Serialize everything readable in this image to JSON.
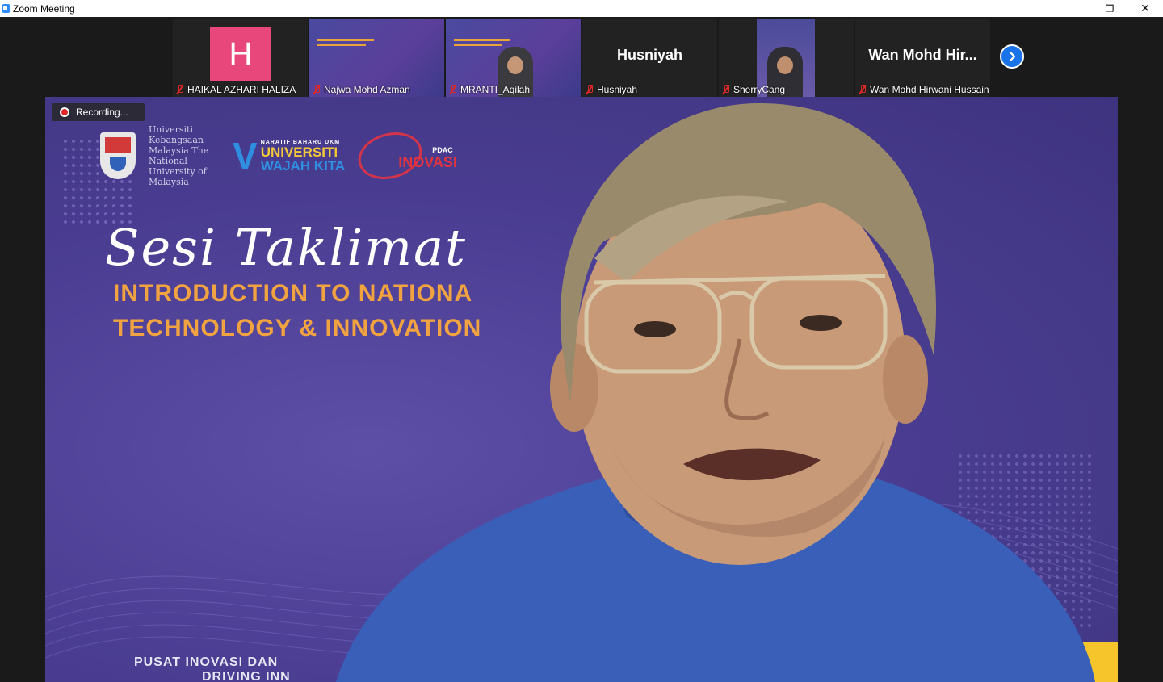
{
  "window": {
    "title": "Zoom Meeting",
    "controls": {
      "minimize": "—",
      "restore": "❐",
      "close": "✕"
    }
  },
  "thumbnails": [
    {
      "name": "HAIKAL AZHARI HALIZA",
      "avatar_letter": "H",
      "muted": true,
      "type": "avatar",
      "avatar_color": "#e8477b"
    },
    {
      "name": "Najwa Mohd Azman",
      "muted": true,
      "type": "slide"
    },
    {
      "name": "MRANTI_Aqilah",
      "muted": true,
      "type": "slide-person"
    },
    {
      "name": "Husniyah",
      "display_name": "Husniyah",
      "muted": true,
      "type": "name"
    },
    {
      "name": "SherryCang",
      "muted": true,
      "type": "person"
    },
    {
      "name": "Wan Mohd Hirwani Hussain",
      "display_name": "Wan Mohd Hir...",
      "muted": true,
      "type": "name"
    }
  ],
  "next_icon": "chevron-right-icon",
  "recording": {
    "label": "Recording..."
  },
  "slide": {
    "ukm_text": "Universiti Kebangsaan Malaysia The National University of Malaysia",
    "wuk_small": "NARATIF BAHARU UKM",
    "wuk_line1": "UNIVERSITI",
    "wuk_line2": "WAJAH KITA",
    "pd_small": "PDAC",
    "pd_word": "INOVASI",
    "script_title": "Sesi Taklimat",
    "line1": "INTRODUCTION TO NATIONA",
    "line2": "TECHNOLOGY & INNOVATION",
    "footer1": "PUSAT INOVASI DAN",
    "footer2": "DRIVING INN"
  },
  "colors": {
    "accent": "#2d8cff",
    "slide_orange": "#f0a340",
    "muted_red": "#e02828"
  }
}
